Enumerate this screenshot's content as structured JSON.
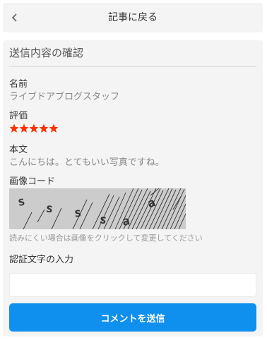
{
  "header": {
    "back_icon": "chevron-left-icon",
    "title": "記事に戻る"
  },
  "confirm": {
    "title": "送信内容の確認",
    "name_label": "名前",
    "name_value": "ライブドアブログスタッフ",
    "rating_label": "評価",
    "rating": 5,
    "rating_max": 5,
    "body_label": "本文",
    "body_value": "こんにちは。とてもいい写真ですね。",
    "captcha_label": "画像コード",
    "captcha_text": "s s s s a a",
    "captcha_hint": "読みにくい場合は画像をクリックして変更してください",
    "code_input_label": "認証文字の入力",
    "code_input_value": "",
    "submit_label": "コメントを送信"
  },
  "colors": {
    "accent": "#0f8fee",
    "star": "#ff3300",
    "panel_bg": "#f4f4f4"
  }
}
